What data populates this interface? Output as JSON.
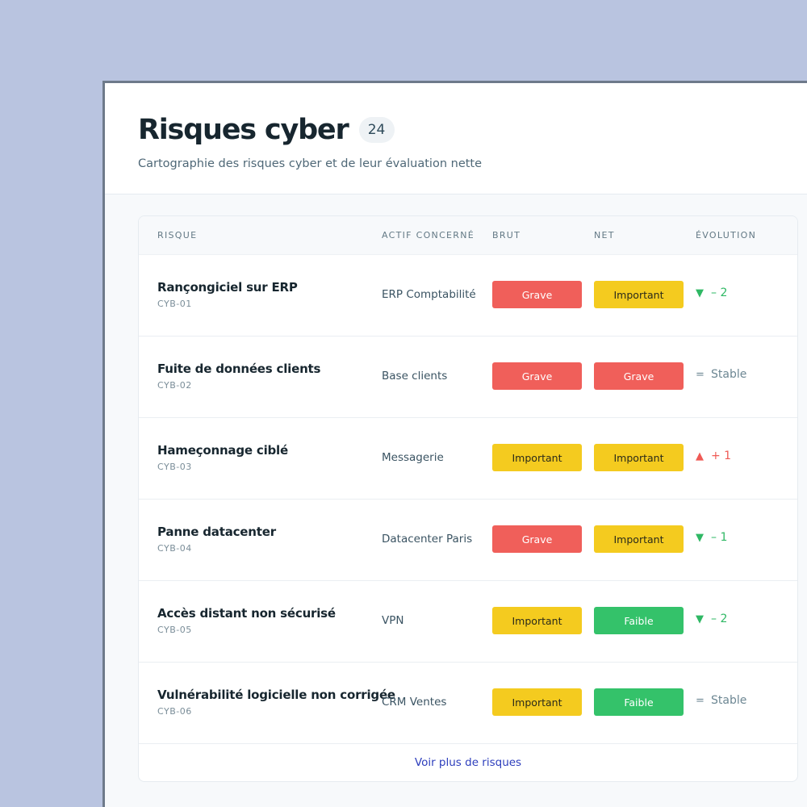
{
  "header": {
    "title": "Risques cyber",
    "count": "24",
    "subtitle": "Cartographie des risques cyber et de leur évaluation nette"
  },
  "table": {
    "columns": {
      "risk": "Risque",
      "asset": "Actif concerné",
      "brut": "Brut",
      "net": "Net",
      "evolution": "Évolution"
    },
    "rows": [
      {
        "name": "Rançongiciel sur ERP",
        "code": "CYB-01",
        "asset": "ERP Comptabilité",
        "brut": "Grave",
        "net": "Important",
        "evo_icon": "triangle-down-icon",
        "evo": "– 2",
        "evo_dir": "down"
      },
      {
        "name": "Fuite de données clients",
        "code": "CYB-02",
        "asset": "Base clients",
        "brut": "Grave",
        "net": "Grave",
        "evo_icon": "equals-icon",
        "evo": "Stable",
        "evo_dir": "stable"
      },
      {
        "name": "Hameçonnage ciblé",
        "code": "CYB-03",
        "asset": "Messagerie",
        "brut": "Important",
        "net": "Important",
        "evo_icon": "triangle-up-icon",
        "evo": "+ 1",
        "evo_dir": "up"
      },
      {
        "name": "Panne datacenter",
        "code": "CYB-04",
        "asset": "Datacenter Paris",
        "brut": "Grave",
        "net": "Important",
        "evo_icon": "triangle-down-icon",
        "evo": "– 1",
        "evo_dir": "down"
      },
      {
        "name": "Accès distant non sécurisé",
        "code": "CYB-05",
        "asset": "VPN",
        "brut": "Important",
        "net": "Faible",
        "evo_icon": "triangle-down-icon",
        "evo": "– 2",
        "evo_dir": "down"
      },
      {
        "name": "Vulnérabilité logicielle non corrigée",
        "code": "CYB-06",
        "asset": "CRM Ventes",
        "brut": "Important",
        "net": "Faible",
        "evo_icon": "equals-icon",
        "evo": "Stable",
        "evo_dir": "stable"
      }
    ],
    "more_label": "Voir plus de risques"
  },
  "colors": {
    "background": "#b9c4e0",
    "grave": "#f05f5a",
    "important": "#f4cb1f",
    "faible": "#34c26a",
    "trend_down": "#2fb864",
    "trend_up": "#ef5a55",
    "link": "#2c3dbc"
  }
}
